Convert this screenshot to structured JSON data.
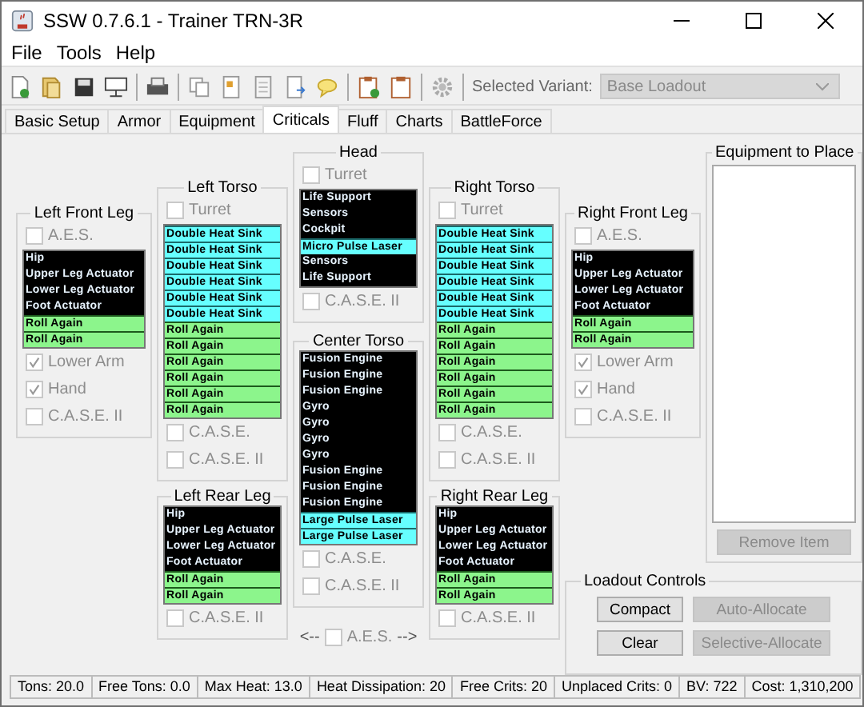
{
  "window": {
    "title": "SSW 0.7.6.1 - Trainer TRN-3R"
  },
  "menu": [
    "File",
    "Tools",
    "Help"
  ],
  "variant": {
    "label": "Selected Variant:",
    "value": "Base Loadout",
    "disabled": true
  },
  "tabs": [
    {
      "label": "Basic Setup",
      "selected": false
    },
    {
      "label": "Armor",
      "selected": false
    },
    {
      "label": "Equipment",
      "selected": false
    },
    {
      "label": "Criticals",
      "selected": true
    },
    {
      "label": "Fluff",
      "selected": false
    },
    {
      "label": "Charts",
      "selected": false
    },
    {
      "label": "BattleForce",
      "selected": false
    }
  ],
  "locations": [
    {
      "title": "Left Front Leg",
      "checks_above": [
        {
          "label": "A.E.S.",
          "checked": false,
          "disabled": true
        }
      ],
      "slots": [
        {
          "text": "Hip",
          "kind": "system"
        },
        {
          "text": "Upper Leg Actuator",
          "kind": "system"
        },
        {
          "text": "Lower Leg Actuator",
          "kind": "system"
        },
        {
          "text": "Foot Actuator",
          "kind": "system"
        },
        {
          "text": "Roll Again",
          "kind": "empty"
        },
        {
          "text": "Roll Again",
          "kind": "empty"
        }
      ],
      "checks_below": [
        {
          "label": "Lower Arm",
          "checked": true,
          "disabled": true
        },
        {
          "label": "Hand",
          "checked": true,
          "disabled": true
        },
        {
          "label": "C.A.S.E. II",
          "checked": false,
          "disabled": true
        }
      ]
    },
    {
      "title": "Left Torso",
      "checks_above": [
        {
          "label": "Turret",
          "checked": false,
          "disabled": true
        }
      ],
      "slots": [
        {
          "text": "Double Heat Sink",
          "kind": "equipment"
        },
        {
          "text": "Double Heat Sink",
          "kind": "equipment"
        },
        {
          "text": "Double Heat Sink",
          "kind": "equipment"
        },
        {
          "text": "Double Heat Sink",
          "kind": "equipment"
        },
        {
          "text": "Double Heat Sink",
          "kind": "equipment"
        },
        {
          "text": "Double Heat Sink",
          "kind": "equipment"
        },
        {
          "text": "Roll Again",
          "kind": "empty"
        },
        {
          "text": "Roll Again",
          "kind": "empty"
        },
        {
          "text": "Roll Again",
          "kind": "empty"
        },
        {
          "text": "Roll Again",
          "kind": "empty"
        },
        {
          "text": "Roll Again",
          "kind": "empty"
        },
        {
          "text": "Roll Again",
          "kind": "empty"
        }
      ],
      "checks_below": [
        {
          "label": "C.A.S.E.",
          "checked": false,
          "disabled": true
        },
        {
          "label": "C.A.S.E. II",
          "checked": false,
          "disabled": true
        }
      ]
    },
    {
      "title": "Left Rear Leg",
      "slots": [
        {
          "text": "Hip",
          "kind": "system"
        },
        {
          "text": "Upper Leg Actuator",
          "kind": "system"
        },
        {
          "text": "Lower Leg Actuator",
          "kind": "system"
        },
        {
          "text": "Foot Actuator",
          "kind": "system"
        },
        {
          "text": "Roll Again",
          "kind": "empty"
        },
        {
          "text": "Roll Again",
          "kind": "empty"
        }
      ],
      "checks_below": [
        {
          "label": "C.A.S.E. II",
          "checked": false,
          "disabled": true
        }
      ]
    },
    {
      "title": "Head",
      "checks_above": [
        {
          "label": "Turret",
          "checked": false,
          "disabled": true
        }
      ],
      "slots": [
        {
          "text": "Life Support",
          "kind": "system"
        },
        {
          "text": "Sensors",
          "kind": "system"
        },
        {
          "text": "Cockpit",
          "kind": "system"
        },
        {
          "text": "Micro Pulse Laser",
          "kind": "equipment"
        },
        {
          "text": "Sensors",
          "kind": "system"
        },
        {
          "text": "Life Support",
          "kind": "system"
        }
      ],
      "checks_below": [
        {
          "label": "C.A.S.E. II",
          "checked": false,
          "disabled": true
        }
      ]
    },
    {
      "title": "Center Torso",
      "slots": [
        {
          "text": "Fusion Engine",
          "kind": "system"
        },
        {
          "text": "Fusion Engine",
          "kind": "system"
        },
        {
          "text": "Fusion Engine",
          "kind": "system"
        },
        {
          "text": "Gyro",
          "kind": "system"
        },
        {
          "text": "Gyro",
          "kind": "system"
        },
        {
          "text": "Gyro",
          "kind": "system"
        },
        {
          "text": "Gyro",
          "kind": "system"
        },
        {
          "text": "Fusion Engine",
          "kind": "system"
        },
        {
          "text": "Fusion Engine",
          "kind": "system"
        },
        {
          "text": "Fusion Engine",
          "kind": "system"
        },
        {
          "text": "Large Pulse Laser",
          "kind": "equipment"
        },
        {
          "text": "Large Pulse Laser",
          "kind": "equipment"
        }
      ],
      "checks_below": [
        {
          "label": "C.A.S.E.",
          "checked": false,
          "disabled": true
        },
        {
          "label": "C.A.S.E. II",
          "checked": false,
          "disabled": true
        }
      ]
    },
    {
      "title": "Right Torso",
      "checks_above": [
        {
          "label": "Turret",
          "checked": false,
          "disabled": true
        }
      ],
      "slots": [
        {
          "text": "Double Heat Sink",
          "kind": "equipment"
        },
        {
          "text": "Double Heat Sink",
          "kind": "equipment"
        },
        {
          "text": "Double Heat Sink",
          "kind": "equipment"
        },
        {
          "text": "Double Heat Sink",
          "kind": "equipment"
        },
        {
          "text": "Double Heat Sink",
          "kind": "equipment"
        },
        {
          "text": "Double Heat Sink",
          "kind": "equipment"
        },
        {
          "text": "Roll Again",
          "kind": "empty"
        },
        {
          "text": "Roll Again",
          "kind": "empty"
        },
        {
          "text": "Roll Again",
          "kind": "empty"
        },
        {
          "text": "Roll Again",
          "kind": "empty"
        },
        {
          "text": "Roll Again",
          "kind": "empty"
        },
        {
          "text": "Roll Again",
          "kind": "empty"
        }
      ],
      "checks_below": [
        {
          "label": "C.A.S.E.",
          "checked": false,
          "disabled": true
        },
        {
          "label": "C.A.S.E. II",
          "checked": false,
          "disabled": true
        }
      ]
    },
    {
      "title": "Right Rear Leg",
      "slots": [
        {
          "text": "Hip",
          "kind": "system"
        },
        {
          "text": "Upper Leg Actuator",
          "kind": "system"
        },
        {
          "text": "Lower Leg Actuator",
          "kind": "system"
        },
        {
          "text": "Foot Actuator",
          "kind": "system"
        },
        {
          "text": "Roll Again",
          "kind": "empty"
        },
        {
          "text": "Roll Again",
          "kind": "empty"
        }
      ],
      "checks_below": [
        {
          "label": "C.A.S.E. II",
          "checked": false,
          "disabled": true
        }
      ]
    },
    {
      "title": "Right Front Leg",
      "checks_above": [
        {
          "label": "A.E.S.",
          "checked": false,
          "disabled": true
        }
      ],
      "slots": [
        {
          "text": "Hip",
          "kind": "system"
        },
        {
          "text": "Upper Leg Actuator",
          "kind": "system"
        },
        {
          "text": "Lower Leg Actuator",
          "kind": "system"
        },
        {
          "text": "Foot Actuator",
          "kind": "system"
        },
        {
          "text": "Roll Again",
          "kind": "empty"
        },
        {
          "text": "Roll Again",
          "kind": "empty"
        }
      ],
      "checks_below": [
        {
          "label": "Lower Arm",
          "checked": true,
          "disabled": true
        },
        {
          "label": "Hand",
          "checked": true,
          "disabled": true
        },
        {
          "label": "C.A.S.E. II",
          "checked": false,
          "disabled": true
        }
      ]
    }
  ],
  "aes_link": {
    "left": "<--",
    "label": "A.E.S.",
    "right": "-->",
    "checked": false,
    "disabled": true
  },
  "equipment_to_place": {
    "title": "Equipment to Place",
    "remove_button": {
      "label": "Remove Item",
      "disabled": true
    }
  },
  "loadout_controls": {
    "title": "Loadout Controls",
    "buttons": [
      {
        "label": "Compact",
        "disabled": false
      },
      {
        "label": "Auto-Allocate",
        "disabled": true
      },
      {
        "label": "Clear",
        "disabled": false
      },
      {
        "label": "Selective-Allocate",
        "disabled": true
      }
    ]
  },
  "status_bar": [
    "Tons: 20.0",
    "Free Tons: 0.0",
    "Max Heat: 13.0",
    "Heat Dissipation: 20",
    "Free Crits: 20",
    "Unplaced Crits: 0",
    "BV: 722",
    "Cost: 1,310,200"
  ]
}
